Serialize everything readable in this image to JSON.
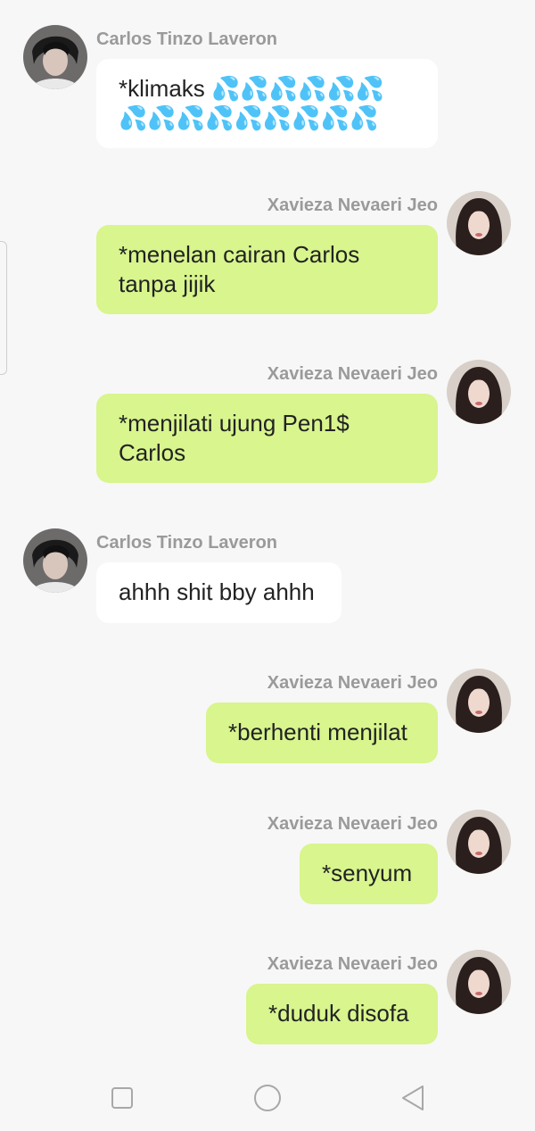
{
  "messages": [
    {
      "sender": "Carlos Tinzo Laveron",
      "direction": "in",
      "text": "*klimaks 💦💦💦💦💦💦\n💦💦💦💦💦💦💦💦💦"
    },
    {
      "sender": "Xavieza Nevaeri Jeo",
      "direction": "out",
      "text": "*menelan cairan Carlos\ntanpa jijik"
    },
    {
      "sender": "Xavieza Nevaeri Jeo",
      "direction": "out",
      "text": "*menjilati ujung Pen1$\nCarlos"
    },
    {
      "sender": "Carlos Tinzo Laveron",
      "direction": "in",
      "text": "ahhh shit bby ahhh"
    },
    {
      "sender": "Xavieza Nevaeri Jeo",
      "direction": "out",
      "text": "*berhenti menjilat"
    },
    {
      "sender": "Xavieza Nevaeri Jeo",
      "direction": "out",
      "text": "*senyum"
    },
    {
      "sender": "Xavieza Nevaeri Jeo",
      "direction": "out",
      "text": "*duduk disofa"
    }
  ],
  "colors": {
    "background": "#f7f7f7",
    "incoming_bubble": "#ffffff",
    "outgoing_bubble": "#d8f58e",
    "sender_name": "#9a9a9a"
  },
  "navbar": {
    "icons": [
      "square-recents-icon",
      "circle-home-icon",
      "triangle-back-icon"
    ]
  }
}
